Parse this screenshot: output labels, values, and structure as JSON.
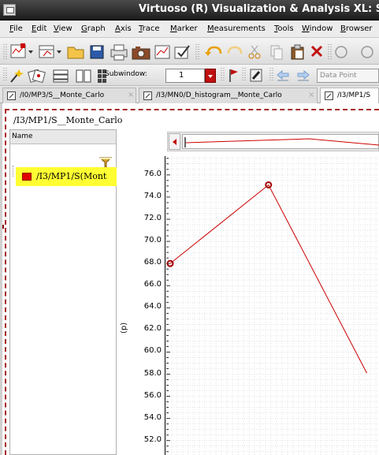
{
  "window": {
    "title": "Virtuoso (R) Visualization & Analysis XL: S"
  },
  "menu": [
    {
      "id": "file",
      "label": "File",
      "mnemonic": "F",
      "rest": "ile"
    },
    {
      "id": "edit",
      "label": "Edit",
      "mnemonic": "E",
      "rest": "dit"
    },
    {
      "id": "view",
      "label": "View",
      "mnemonic": "V",
      "rest": "iew"
    },
    {
      "id": "graph",
      "label": "Graph",
      "mnemonic": "G",
      "rest": "raph"
    },
    {
      "id": "axis",
      "label": "Axis",
      "mnemonic": "A",
      "rest": "xis"
    },
    {
      "id": "trace",
      "label": "Trace",
      "mnemonic": "T",
      "rest": "race"
    },
    {
      "id": "marker",
      "label": "Marker",
      "mnemonic": "M",
      "rest": "arker"
    },
    {
      "id": "measurements",
      "label": "Measurements",
      "mnemonic": "M",
      "rest": "easurements"
    },
    {
      "id": "tools",
      "label": "Tools",
      "mnemonic": "T",
      "rest": "ools"
    },
    {
      "id": "window",
      "label": "Window",
      "mnemonic": "W",
      "rest": "indow"
    },
    {
      "id": "browser",
      "label": "Browser",
      "mnemonic": "B",
      "rest": "rowser"
    }
  ],
  "toolbar2": {
    "subwindow_label": "Subwindow:",
    "subwindow_value": "1",
    "datapoint_placeholder": "Data Point"
  },
  "tabs": [
    {
      "label": "/I0/MP3/S__Monte_Carlo",
      "close": "×",
      "active": false
    },
    {
      "label": "/I3/MN0/D_histogram__Monte_Carlo",
      "close": "×",
      "active": false
    },
    {
      "label": "/I3/MP1/S",
      "close": "",
      "active": true
    }
  ],
  "graph": {
    "title": "/I3/MP1/S__Monte_Carlo",
    "legend_header": "Name",
    "legend_entry": "/I3/MP1/S(Mont"
  },
  "colors": {
    "trace": "#cc0000",
    "legend_highlight": "#ffff33",
    "panel_border": "#a52a2a",
    "grid": "#c8c8c8"
  },
  "chart_data": {
    "type": "line",
    "title": "",
    "xlabel": "",
    "ylabel": "(p)",
    "y_ticks": [
      "76.0",
      "74.0",
      "72.0",
      "70.0",
      "68.0",
      "66.0",
      "64.0",
      "62.0",
      "60.0",
      "58.0",
      "56.0",
      "54.0",
      "52.0"
    ],
    "ylim": [
      50.7,
      77.7
    ],
    "x": [
      1,
      2,
      3
    ],
    "xlim": [
      1,
      3.1
    ],
    "grid": true,
    "series": [
      {
        "name": "/I3/MP1/S(Mont",
        "values": [
          68.0,
          75.1,
          58.1
        ],
        "markers": [
          true,
          true,
          false
        ]
      }
    ]
  }
}
